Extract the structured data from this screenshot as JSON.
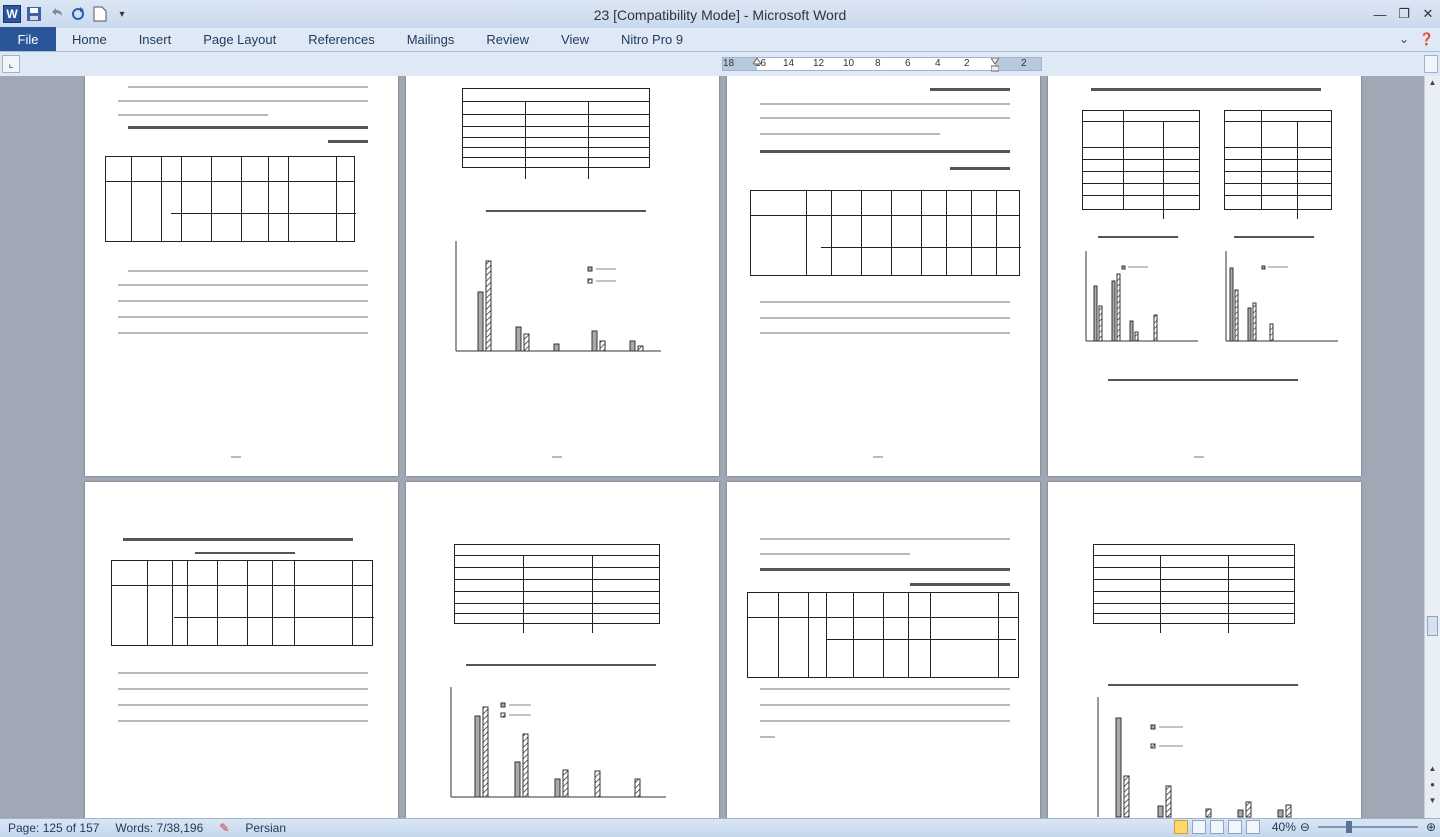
{
  "window": {
    "title": "23 [Compatibility Mode]  -  Microsoft Word",
    "controls": [
      "minimize-icon",
      "restore-icon",
      "close-icon"
    ]
  },
  "quick_access": [
    "word-logo-icon",
    "save-icon",
    "undo-icon",
    "redo-icon",
    "new-document-icon",
    "customize-dropdown-icon"
  ],
  "ribbon": {
    "file_tab": "File",
    "tabs": [
      "Home",
      "Insert",
      "Page Layout",
      "References",
      "Mailings",
      "Review",
      "View",
      "Nitro Pro 9"
    ]
  },
  "ruler": {
    "numbers": [
      "18",
      "16",
      "14",
      "12",
      "10",
      "8",
      "6",
      "4",
      "2",
      "",
      "2"
    ]
  },
  "status_bar": {
    "page": "Page: 125 of 157",
    "words": "Words: 7/38,196",
    "language": "Persian",
    "zoom": "40%"
  },
  "colors": {
    "file_tab": "#2a5699",
    "document_bg": "#a0a8b5",
    "chrome": "#dfe9f5"
  }
}
